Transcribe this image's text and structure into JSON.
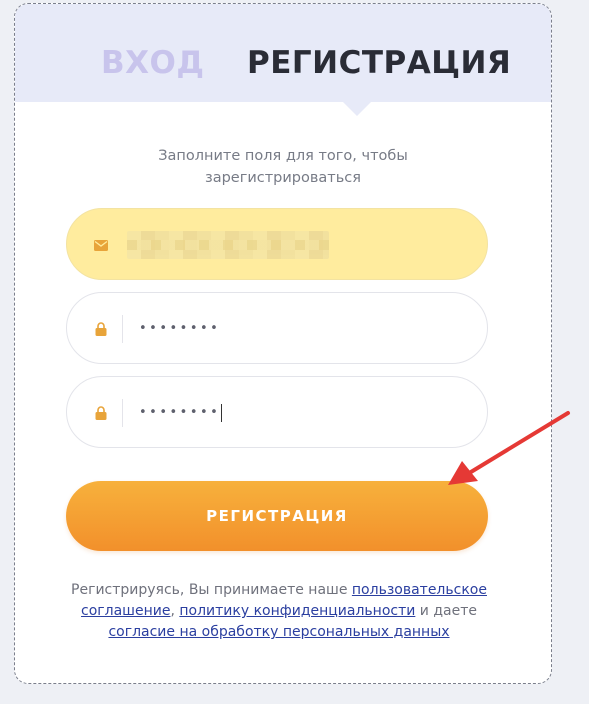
{
  "tabs": {
    "login": "ВХОД",
    "register": "РЕГИСТРАЦИЯ"
  },
  "subtitle": {
    "line1": "Заполните поля для того, чтобы",
    "line2": "зарегистрироваться"
  },
  "fields": {
    "email": {
      "icon": "mail-icon",
      "value": ""
    },
    "password": {
      "icon": "lock-icon",
      "value": "••••••••"
    },
    "password_confirm": {
      "icon": "lock-icon",
      "value": "••••••••"
    }
  },
  "submit_label": "РЕГИСТРАЦИЯ",
  "legal": {
    "prefix": "Регистрируясь, Вы принимаете наше ",
    "link_agreement": "пользовательское соглашение",
    "sep1": ", ",
    "link_privacy": "политику конфиденциальности",
    "mid": " и даете ",
    "link_consent": "согласие на обработку персональных данных"
  },
  "colors": {
    "accent": "#f2902b",
    "active_field": "#ffec9e",
    "icon": "#e8a43a",
    "link": "#2b3fa0",
    "arrow": "#e53935"
  }
}
